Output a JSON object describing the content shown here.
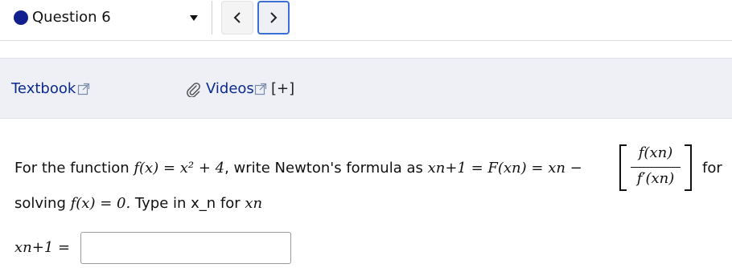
{
  "question_nav": {
    "label": "Question 6",
    "status_color": "#11208e",
    "prev_icon": "chevron-left-icon",
    "next_icon": "chevron-right-icon"
  },
  "resources": {
    "textbook_label": "Textbook",
    "videos_label": "Videos",
    "expand_label": "[+]",
    "icons": [
      "external-link-icon",
      "paperclip-icon"
    ]
  },
  "question": {
    "intro": "For the function",
    "f_def": "f(x) = x² + 4",
    "mid": ", write Newton's formula as",
    "formula_lhs": "xn+1 = F(xn) = xn −",
    "fraction_numerator": "f(xn)",
    "fraction_denominator": "f′(xn)",
    "trailing": "for",
    "line2_prefix": "solving",
    "equation": "f(x) = 0.",
    "type_hint": "Type in x_n for",
    "type_hint_var": "xn",
    "answer_label": "xn+1 ="
  },
  "answer_input": {
    "value": "",
    "placeholder": ""
  }
}
